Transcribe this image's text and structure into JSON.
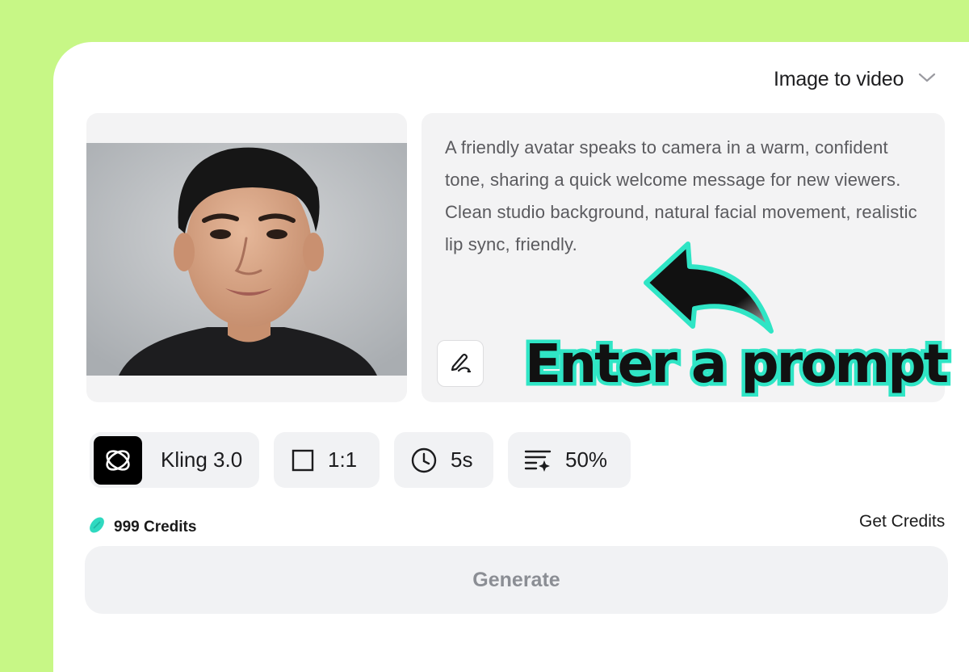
{
  "mode_select": {
    "label": "Image to video",
    "icon": "chevron-down-icon"
  },
  "image_upload": {
    "alt": "Portrait photo of a smiling man in a black t-shirt"
  },
  "prompt": {
    "text": "A friendly avatar speaks to camera in a warm, confident tone, sharing a quick welcome message for new viewers. Clean studio background, natural facial movement, realistic lip sync, friendly.",
    "edit_icon": "edit-prompt-icon"
  },
  "annotation": {
    "callout": "Enter a prompt",
    "arrow_icon": "curved-arrow-icon",
    "accent": "#2fe5c5"
  },
  "settings": {
    "model": {
      "label": "Kling 3.0",
      "icon": "kling-logo-icon"
    },
    "aspect_ratio": {
      "label": "1:1",
      "icon": "square-icon"
    },
    "duration": {
      "label": "5s",
      "icon": "clock-icon"
    },
    "strength": {
      "label": "50%",
      "icon": "sparkle-list-icon"
    }
  },
  "credits": {
    "label": "999 Credits",
    "icon": "credits-bean-icon",
    "get_label": "Get Credits"
  },
  "generate": {
    "label": "Generate"
  },
  "colors": {
    "background": "#c7f786",
    "panel": "#ffffff",
    "card": "#f3f3f4",
    "button_text_disabled": "#8b8e94"
  }
}
